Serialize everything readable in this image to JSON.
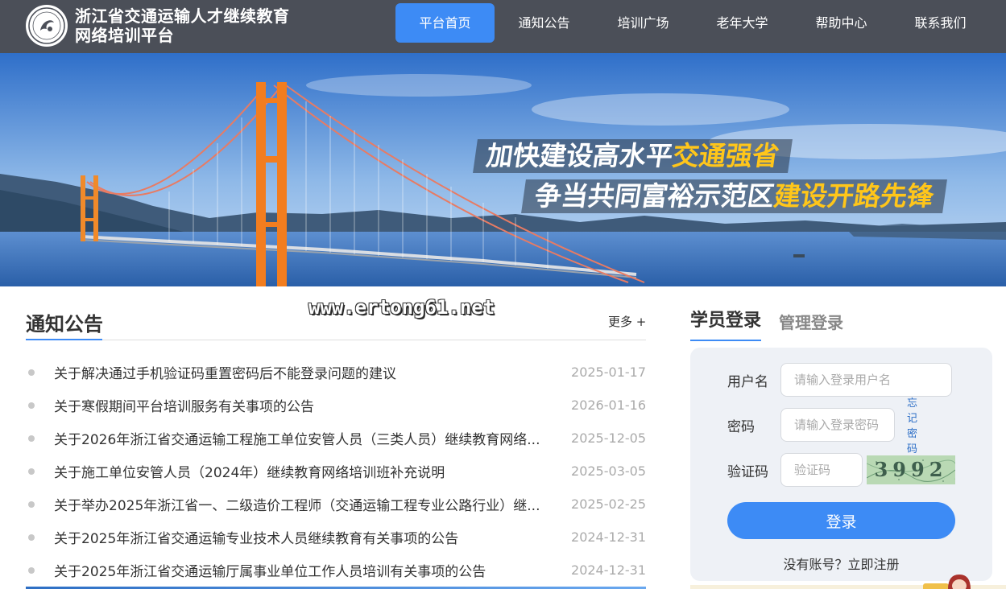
{
  "header": {
    "logo_icon": "platform-logo-icon",
    "title_line1": "浙江省交通运输人才继续教育",
    "title_line2": "网络培训平台",
    "nav": [
      {
        "label": "平台首页",
        "active": true
      },
      {
        "label": "通知公告",
        "active": false
      },
      {
        "label": "培训广场",
        "active": false
      },
      {
        "label": "老年大学",
        "active": false
      },
      {
        "label": "帮助中心",
        "active": false
      },
      {
        "label": "联系我们",
        "active": false
      }
    ],
    "colors": {
      "bar": "#4b4f58",
      "active": "#3d8bf5"
    }
  },
  "banner": {
    "slogan1_main": "加快建设高水平",
    "slogan1_highlight": "交通强省",
    "slogan2_main": "争当共同富裕示范区",
    "slogan2_highlight": "建设开路先锋",
    "highlight_color": "#ffc61a"
  },
  "watermark": "www.ertong61.net",
  "notices": {
    "title": "通知公告",
    "more": "更多 +",
    "items": [
      {
        "text": "关于解决通过手机验证码重置密码后不能登录问题的建议",
        "date": "2025-01-17"
      },
      {
        "text": "关于寒假期间平台培训服务有关事项的公告",
        "date": "2026-01-16"
      },
      {
        "text": "关于2026年浙江省交通运输工程施工单位安管人员（三类人员）继续教育网络...",
        "date": "2025-12-05"
      },
      {
        "text": "关于施工单位安管人员（2024年）继续教育网络培训班补充说明",
        "date": "2025-03-05"
      },
      {
        "text": "关于举办2025年浙江省一、二级造价工程师（交通运输工程专业公路行业）继...",
        "date": "2025-02-25"
      },
      {
        "text": "关于2025年浙江省交通运输专业技术人员继续教育有关事项的公告",
        "date": "2024-12-31"
      },
      {
        "text": "关于2025年浙江省交通运输厅属事业单位工作人员培训有关事项的公告",
        "date": "2024-12-31"
      }
    ]
  },
  "login": {
    "tab_student": "学员登录",
    "tab_admin": "管理登录",
    "username_label": "用户名",
    "username_placeholder": "请输入登录用户名",
    "password_label": "密码",
    "password_placeholder": "请输入登录密码",
    "forgot": "忘记密码",
    "captcha_label": "验证码",
    "captcha_placeholder": "验证码",
    "captcha_text": "3992",
    "submit": "登录",
    "register": "没有账号？立即注册"
  }
}
